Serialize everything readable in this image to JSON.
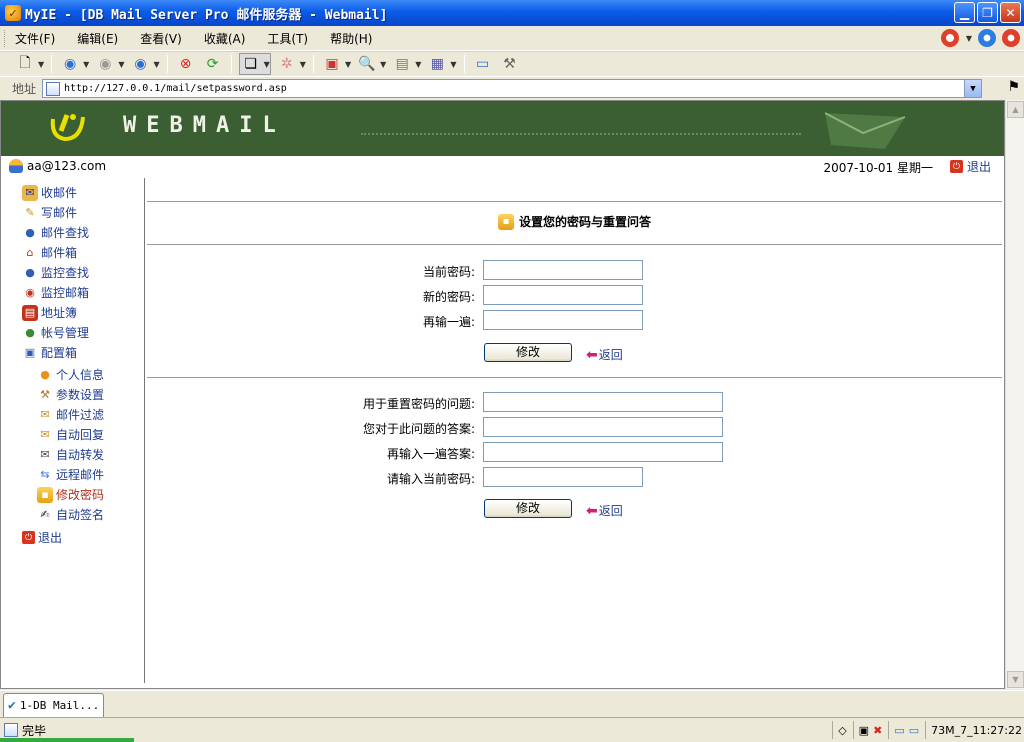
{
  "window": {
    "title": "MyIE - [DB Mail Server Pro 邮件服务器 - Webmail]"
  },
  "menu": [
    "文件(F)",
    "编辑(E)",
    "查看(V)",
    "收藏(A)",
    "工具(T)",
    "帮助(H)"
  ],
  "address": {
    "label": "地址",
    "url": "http://127.0.0.1/mail/setpassword.asp"
  },
  "banner": {
    "brand": "WEBMAIL"
  },
  "user": {
    "email": "aa@123.com",
    "date": "2007-10-01 星期一",
    "logout": "退出"
  },
  "sidebar": {
    "items": [
      "收邮件",
      "写邮件",
      "邮件查找",
      "邮件箱",
      "监控查找",
      "监控邮箱",
      "地址簿",
      "帐号管理",
      "配置箱"
    ],
    "subitems": [
      "个人信息",
      "参数设置",
      "邮件过滤",
      "自动回复",
      "自动转发",
      "远程邮件",
      "修改密码",
      "自动签名"
    ],
    "logout": "退出",
    "active": "修改密码"
  },
  "form": {
    "title": "设置您的密码与重置问答",
    "password": {
      "current_label": "当前密码:",
      "new_label": "新的密码:",
      "repeat_label": "再输一遍:",
      "submit": "修改",
      "back": "返回"
    },
    "reset": {
      "question_label": "用于重置密码的问题:",
      "answer_label": "您对于此问题的答案:",
      "answer_repeat_label": "再输入一遍答案:",
      "current_password_label": "请输入当前密码:",
      "submit": "修改",
      "back": "返回"
    }
  },
  "tabs": [
    {
      "label": "1-DB Mail..."
    }
  ],
  "status": {
    "text": "完毕",
    "clock": "73M_7_11:27:22"
  }
}
